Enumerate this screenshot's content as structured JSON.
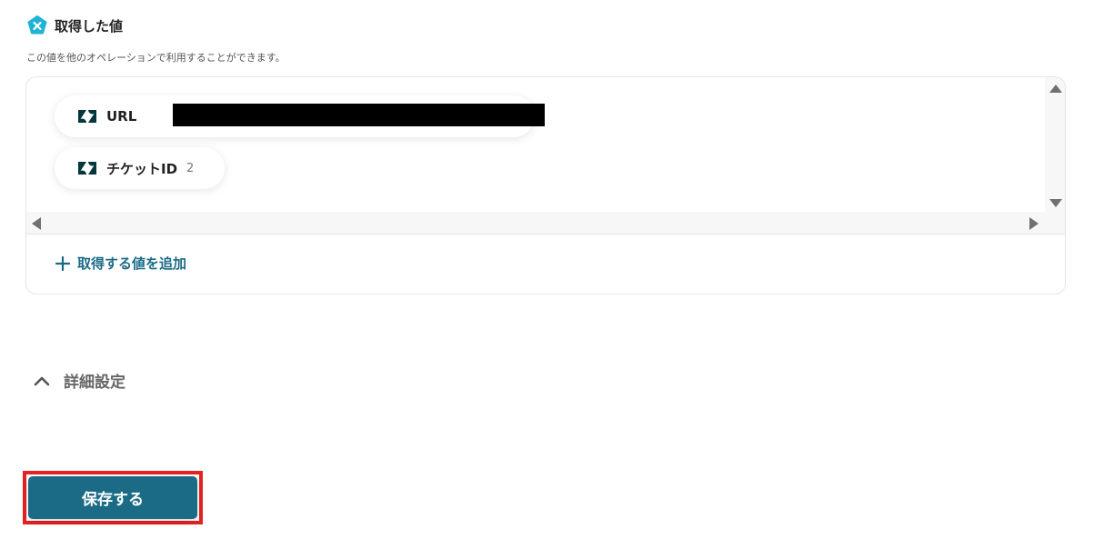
{
  "section": {
    "title": "取得した値",
    "description": "この値を他のオペレーションで利用することができます。",
    "icon": "yoom-badge-icon",
    "icon_color": "#1fb3d6"
  },
  "values": [
    {
      "icon": "zendesk-icon",
      "label": "URL",
      "value": ""
    },
    {
      "icon": "zendesk-icon",
      "label": "チケットID",
      "value": "2"
    }
  ],
  "add_value": {
    "icon": "plus-icon",
    "label": "取得する値を追加"
  },
  "advanced": {
    "icon": "chevron-up-icon",
    "label": "詳細設定"
  },
  "save": {
    "label": "保存する",
    "color": "#1b6b86",
    "highlight_color": "#e52222"
  }
}
